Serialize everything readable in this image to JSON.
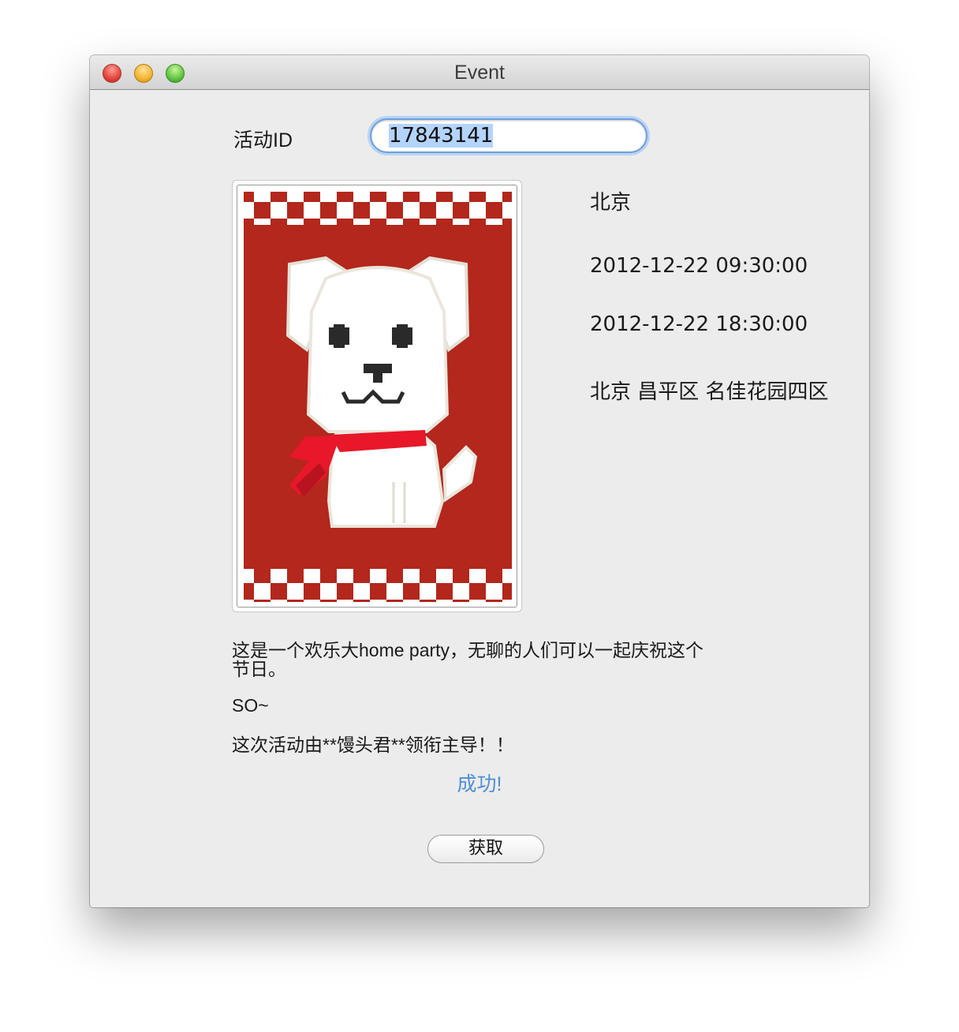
{
  "window": {
    "title": "Event"
  },
  "form": {
    "id_label": "活动ID",
    "id_value": "17843141"
  },
  "event": {
    "city": "北京",
    "start_time": "2012-12-22 09:30:00",
    "end_time": "2012-12-22 18:30:00",
    "address": "北京 昌平区 名佳花园四区",
    "description_line1": "这是一个欢乐大home party，无聊的人们可以一起庆祝这个",
    "description_line2": "节日。",
    "description_line3": "SO~",
    "description_line4": "这次活动由**馒头君**领衔主导！！"
  },
  "status_text": "成功!",
  "fetch_button": "获取",
  "colors": {
    "poster_red": "#b3271c",
    "scarf_red": "#e8172a",
    "focus_ring": "#6da0de",
    "status_blue": "#4e8fd5"
  },
  "icons": [
    "close-button",
    "minimize-button",
    "zoom-button",
    "dog-poster-image"
  ]
}
